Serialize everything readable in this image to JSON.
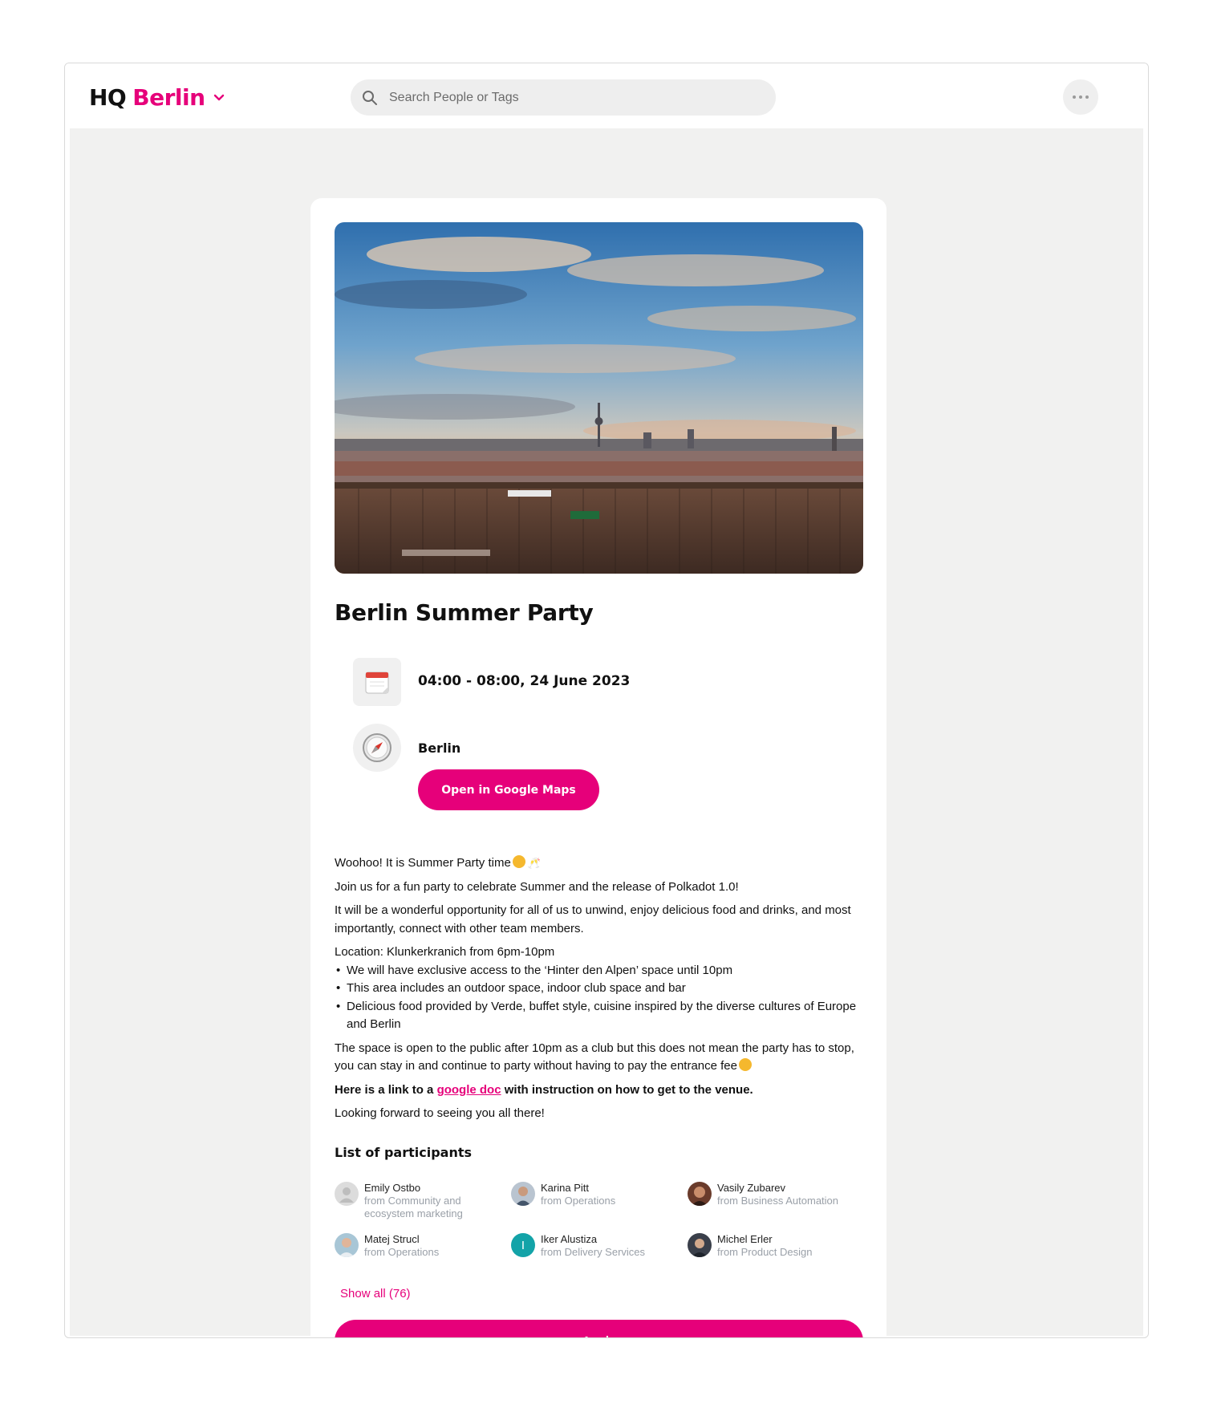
{
  "header": {
    "logo_prefix": "HQ",
    "logo_city": "Berlin",
    "search_placeholder": "Search People or Tags"
  },
  "event": {
    "title": "Berlin Summer Party",
    "datetime": "04:00 - 08:00, 24 June 2023",
    "location": "Berlin",
    "maps_button": "Open in Google Maps"
  },
  "description": {
    "line1": "Woohoo! It is Summer Party time",
    "line2": "Join us for a fun party to celebrate Summer and the release of Polkadot 1.0!",
    "line3": "It will be a wonderful opportunity for all of us to unwind, enjoy delicious food and drinks, and most importantly, connect with other team members.",
    "location_line": "Location: Klunkerkranich from 6pm-10pm",
    "bullets": [
      "We will have exclusive access to the ‘Hinter den Alpen’ space until 10pm",
      "This area includes an outdoor space, indoor club space and bar",
      "Delicious food provided by Verde, buffet style, cuisine inspired by the diverse cultures of Europe and Berlin"
    ],
    "public_line": "The space is open to the public after 10pm as a club but this does not mean the party has to stop, you can stay in and continue to party without having to pay the entrance fee",
    "link_prefix": "Here is a link to a ",
    "link_text": "google doc",
    "link_suffix": " with instruction on how to get to the venue.",
    "closing": "Looking forward to seeing you all there!"
  },
  "participants": {
    "heading": "List of participants",
    "items": [
      {
        "name": "Emily Ostbo",
        "team": "from Community and ecosystem marketing",
        "avatar": "placeholder",
        "color": "#d9d9d9"
      },
      {
        "name": "Karina Pitt",
        "team": "from Operations",
        "avatar": "photo",
        "color": "#8a96a6"
      },
      {
        "name": "Vasily Zubarev",
        "team": "from Business Automation",
        "avatar": "photo",
        "color": "#6a3b2b"
      },
      {
        "name": "Matej Strucl",
        "team": "from Operations",
        "avatar": "photo",
        "color": "#7fa3b8"
      },
      {
        "name": "Iker Alustiza",
        "team": "from Delivery Services",
        "avatar": "initial",
        "initial": "I",
        "color": "#13a3a8"
      },
      {
        "name": "Michel Erler",
        "team": "from Product Design",
        "avatar": "photo",
        "color": "#3a3f4a"
      }
    ],
    "show_all": "Show all (76)"
  },
  "apply_button": "Apply",
  "colors": {
    "accent": "#e6007a",
    "background": "#f1f1f0"
  }
}
